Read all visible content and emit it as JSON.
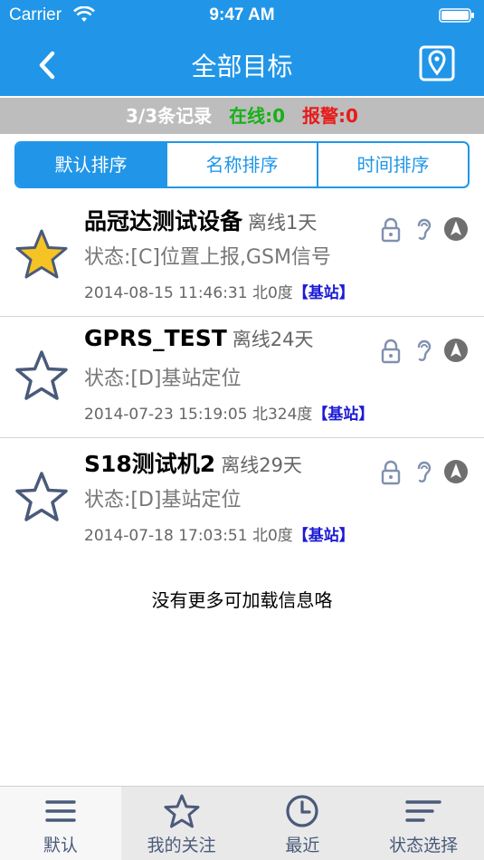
{
  "status_bar": {
    "carrier": "Carrier",
    "time": "9:47 AM"
  },
  "nav": {
    "title": "全部目标",
    "back_icon": "chevron-left-icon",
    "map_icon": "map-pin-icon"
  },
  "summary": {
    "count": "3/3条记录",
    "online": "在线:0",
    "alarm": "报警:0"
  },
  "sort_tabs": [
    {
      "label": "默认排序",
      "active": true
    },
    {
      "label": "名称排序",
      "active": false
    },
    {
      "label": "时间排序",
      "active": false
    }
  ],
  "devices": [
    {
      "name": "品冠达测试设备",
      "offline": "离线1天",
      "status": "状态:[C]位置上报,GSM信号",
      "time": "2014-08-15 11:46:31",
      "direction": "北0度",
      "source": "【基站】",
      "starred": true
    },
    {
      "name": "GPRS_TEST",
      "offline": "离线24天",
      "status": "状态:[D]基站定位",
      "time": "2014-07-23 15:19:05",
      "direction": "北324度",
      "source": "【基站】",
      "starred": false
    },
    {
      "name": "S18测试机2",
      "offline": "离线29天",
      "status": "状态:[D]基站定位",
      "time": "2014-07-18 17:03:51",
      "direction": "北0度",
      "source": "【基站】",
      "starred": false
    }
  ],
  "no_more_text": "没有更多可加载信息咯",
  "tab_bar": [
    {
      "label": "默认",
      "icon": "list-icon",
      "active": true
    },
    {
      "label": "我的关注",
      "icon": "star-icon",
      "active": false
    },
    {
      "label": "最近",
      "icon": "clock-icon",
      "active": false
    },
    {
      "label": "状态选择",
      "icon": "filter-icon",
      "active": false
    }
  ],
  "colors": {
    "primary": "#2196e8",
    "online": "#18b018",
    "alarm": "#e81b1b",
    "star_filled": "#f6c324",
    "star_outline": "#4a5a7a",
    "source": "#1a1ad6"
  }
}
